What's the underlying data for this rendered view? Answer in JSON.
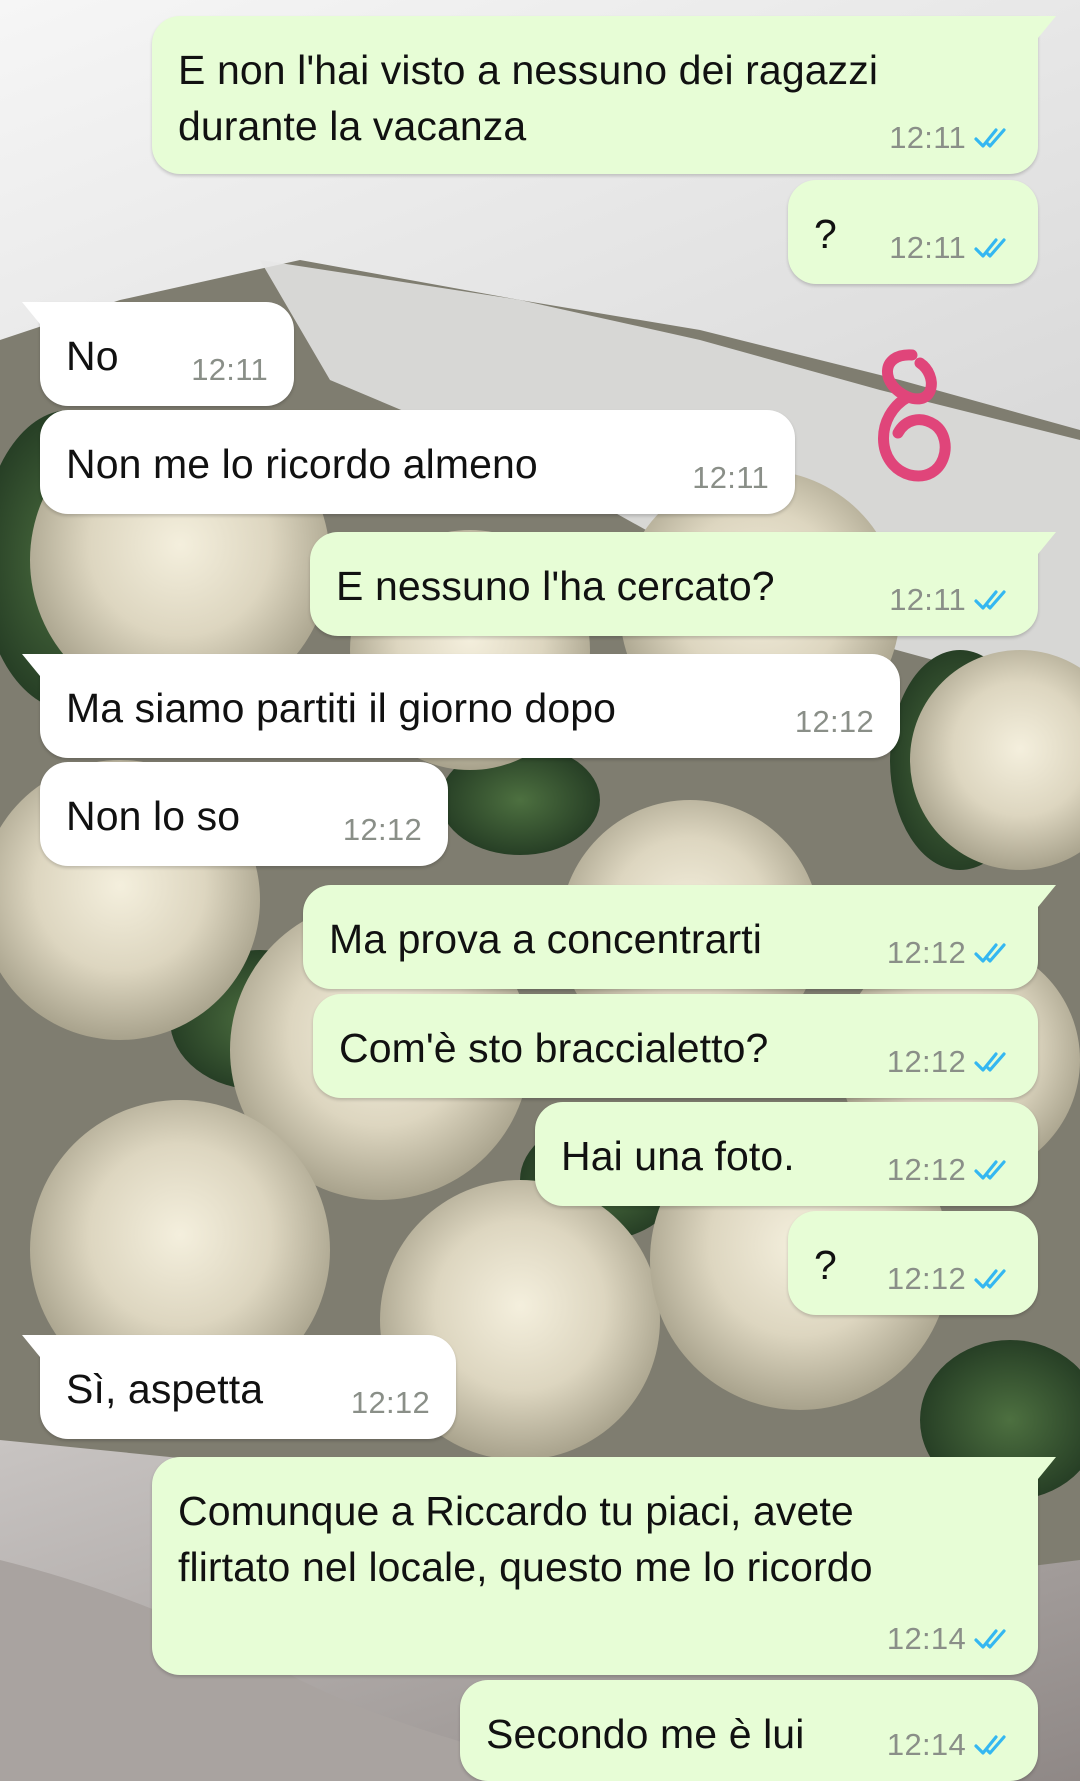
{
  "theme": {
    "outgoing_bubble": "#e7fdd6",
    "incoming_bubble": "#ffffff",
    "read_ticks": "#34b7f1",
    "timestamp": "#8a8f88",
    "annotation_stroke": "#e0457a"
  },
  "messages": [
    {
      "direction": "out",
      "text": "E non l'hai visto a nessuno dei ragazzi\ndurante la vacanza",
      "time": "12:11",
      "status": "read-double-tick-icon"
    },
    {
      "direction": "out",
      "text": "?",
      "time": "12:11",
      "status": "read-double-tick-icon"
    },
    {
      "direction": "in",
      "text": "No",
      "time": "12:11"
    },
    {
      "direction": "in",
      "text": "Non me lo ricordo almeno",
      "time": "12:11"
    },
    {
      "direction": "out",
      "text": "E nessuno l'ha cercato?",
      "time": "12:11",
      "status": "read-double-tick-icon"
    },
    {
      "direction": "in",
      "text": "Ma siamo partiti il giorno dopo",
      "time": "12:12"
    },
    {
      "direction": "in",
      "text": "Non lo so",
      "time": "12:12"
    },
    {
      "direction": "out",
      "text": "Ma prova a concentrarti",
      "time": "12:12",
      "status": "read-double-tick-icon"
    },
    {
      "direction": "out",
      "text": "Com'è sto braccialetto?",
      "time": "12:12",
      "status": "read-double-tick-icon"
    },
    {
      "direction": "out",
      "text": "Hai una foto.",
      "time": "12:12",
      "status": "read-double-tick-icon"
    },
    {
      "direction": "out",
      "text": "?",
      "time": "12:12",
      "status": "read-double-tick-icon"
    },
    {
      "direction": "in",
      "text": "Sì, aspetta",
      "time": "12:12"
    },
    {
      "direction": "out",
      "text": "Comunque a Riccardo tu piaci, avete\nflirtato nel locale, questo me lo ricordo",
      "time": "12:14",
      "status": "read-double-tick-icon"
    },
    {
      "direction": "out",
      "text": "Secondo me è lui",
      "time": "12:14",
      "status": "read-double-tick-icon"
    }
  ],
  "annotation": {
    "icon": "hand-drawn-figure-eight-icon"
  }
}
